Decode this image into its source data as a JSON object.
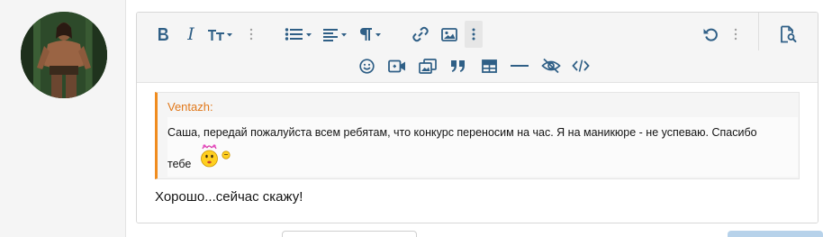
{
  "avatar": {
    "alt": "user-avatar"
  },
  "toolbar": {
    "row1": [
      "bold-icon",
      "italic-icon",
      "font-size-icon",
      "more-vertical-icon",
      "list-icon",
      "align-icon",
      "paragraph-icon",
      "link-icon",
      "image-icon",
      "more-vertical-icon",
      "undo-icon",
      "more-vertical-icon",
      "preview-icon"
    ],
    "row2": [
      "smilie-icon",
      "media-icon",
      "gallery-icon",
      "quote-icon",
      "table-icon",
      "horizontal-line-icon",
      "spoiler-icon",
      "code-icon"
    ],
    "italic_label": "I"
  },
  "quote": {
    "author": "Ventazh:",
    "line1": "Саша, передай пожалуйста всем ребятам, что конкурс переносим на час. Я на маникюре - не успеваю. Спасибо",
    "line2": "тебе"
  },
  "reply": {
    "text": "Хорошо...сейчас скажу!"
  },
  "colors": {
    "accent": "#2f5f86",
    "quote_border": "#f08c1e",
    "quote_author": "#e1781a"
  }
}
